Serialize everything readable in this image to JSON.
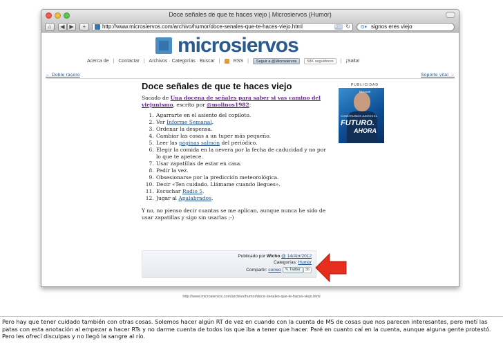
{
  "browser": {
    "window_title": "Doce señales de que te haces viejo | Microsiervos (Humor)",
    "url": "http://www.microsiervos.com/archivo/humor/doce-senales-que-te-haces-viejo.html",
    "rss_badge": "RSS",
    "search_value": "signos eres viejo"
  },
  "site": {
    "logo_text": "microsiervos",
    "nav": {
      "acerca": "Acerca de",
      "contactar": "Contactar",
      "archivos": "Archivos · Categorías · Buscar",
      "rss": "RSS",
      "follow": "Seguir a @Microsiervos",
      "followers": "58K seguidores",
      "salta": "¡Salta!"
    },
    "prev_link": "← Doble rasero",
    "next_link": "Soporte vital →",
    "ad_label": "PUBLICIDAD",
    "ad": {
      "brand": "Microsoft",
      "small": "CONSTRUIMOS JUNTOS EL",
      "futuro": "FUTURO.",
      "ahora": "AHORA"
    }
  },
  "article": {
    "title": "Doce señales de que te haces viejo",
    "intro_pre": "Sacado de ",
    "intro_link": "Una docena de señales para saber si vas camino del viejunismo",
    "intro_mid": ", escrito por ",
    "intro_author": "@molinos1982",
    "intro_post": ":",
    "items": [
      {
        "pre": "Agarrarte en el asiento del copiloto.",
        "link": "",
        "post": ""
      },
      {
        "pre": "Ver ",
        "link": "Informe Semanal",
        "post": "."
      },
      {
        "pre": "Ordenar la despensa.",
        "link": "",
        "post": ""
      },
      {
        "pre": "Cambiar las cosas a un tuper más pequeño.",
        "link": "",
        "post": ""
      },
      {
        "pre": "Leer las ",
        "link": "páginas salmón",
        "post": " del periódico."
      },
      {
        "pre": "Elegir la comida en la nevera por la fecha de caducidad y no por lo que te apetece.",
        "link": "",
        "post": ""
      },
      {
        "pre": "Usar zapatillas de estar en casa.",
        "link": "",
        "post": ""
      },
      {
        "pre": "Pedir la vez.",
        "link": "",
        "post": ""
      },
      {
        "pre": "Obsesionarse por la predicción meteorológica.",
        "link": "",
        "post": ""
      },
      {
        "pre": "Decir «Ten cuidado. Llámame cuando llegues».",
        "link": "",
        "post": ""
      },
      {
        "pre": "Escuchar ",
        "link": "Radio 5",
        "post": "."
      },
      {
        "pre": "Jugar al ",
        "link": "Apalabrados",
        "post": "."
      }
    ],
    "closing": "Y no, no pienso decir cuantas se me aplican, aunque nunca he sido de usar zapatillas y sigo sin usarlas ;-)"
  },
  "meta": {
    "published_pre": "Publicado por ",
    "author": "Wicho",
    "date": "14/Abr/2012",
    "categories_label": "Categorías: ",
    "category": "Humor",
    "share_label": "Compartir: ",
    "share_mail": "correo",
    "twitter_label": "Twitter",
    "twitter_count": "36"
  },
  "status_url": "http://www.microsiervos.com/archivo/humor/doce-senales-que-te-haces-viejo.html",
  "caption": "Pero hay que tener cuidado también con otras cosas. Solemos hacer algún RT de vez en cuando con la cuenta de MS de cosas que nos parecen interesantes, pero metí las patas con esta anotación al empezar a hacer RTs y no darme cuenta de todos los que iba a tener que hacer. Paré en cuanto caí en la cuenta, aunque alguna gente protestó. Pero les ofrecí disculpas y no llegó la sangre al río.",
  "colors": {
    "arrow": "#e62e1e",
    "link": "#1b4f86",
    "logo": "#2a5a8e"
  }
}
